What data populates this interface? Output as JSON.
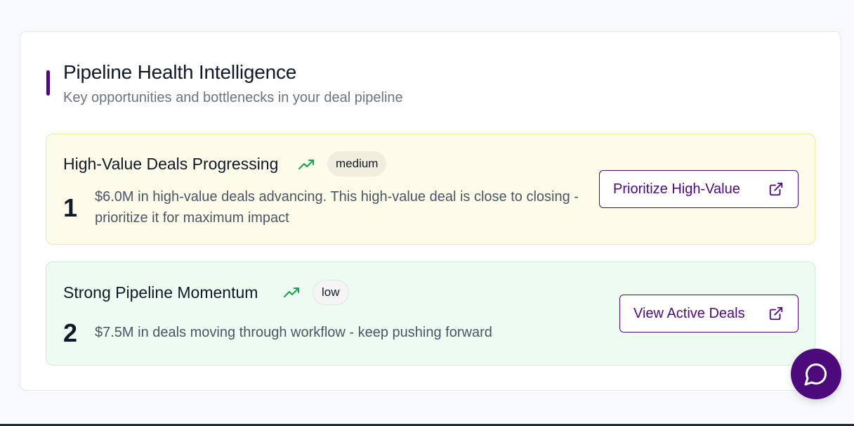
{
  "header": {
    "title": "Pipeline Health Intelligence",
    "subtitle": "Key opportunities and bottlenecks in your deal pipeline"
  },
  "insights": [
    {
      "rank": "1",
      "title": "High-Value Deals Progressing",
      "priority": "medium",
      "trend_icon": "trending-up-icon",
      "description": "$6.0M in high-value deals advancing. This high-value deal is close to closing - prioritize it for maximum impact",
      "action_label": "Prioritize High-Value",
      "action_icon": "external-link-icon"
    },
    {
      "rank": "2",
      "title": "Strong Pipeline Momentum",
      "priority": "low",
      "trend_icon": "trending-up-icon",
      "description": "$7.5M in deals moving through workflow - keep pushing forward",
      "action_label": "View Active Deals",
      "action_icon": "external-link-icon"
    }
  ],
  "chat": {
    "icon": "chat-bubble-icon"
  },
  "colors": {
    "accent": "#4c0a7a",
    "trend_green": "#16a34a",
    "medium_bg": "#fdfbea",
    "low_bg": "#eefbf2"
  }
}
